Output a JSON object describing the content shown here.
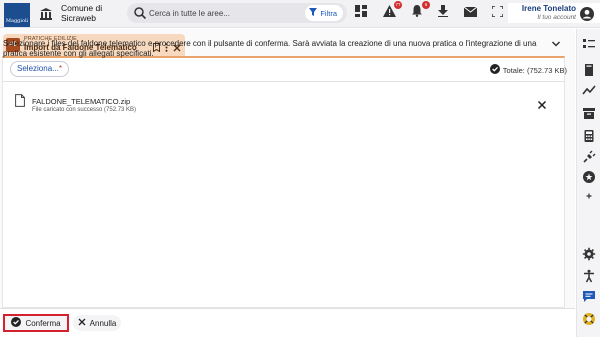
{
  "header": {
    "logo_text": "Maggioli",
    "org_line1": "Comune di",
    "org_line2": "Sicraweb",
    "search_placeholder": "Cerca in tutte le aree...",
    "filter_label": "Filtra",
    "alerts_count": "77",
    "notifications_count": "6",
    "user_name": "Irene Tonelato",
    "user_sub": "Il tuo account"
  },
  "tab": {
    "super_label": "PRATICHE EDILIZIE",
    "title": "Import da Faldone Telematico",
    "icon_text": "PE"
  },
  "content": {
    "instruction": "Selezionare i files del faldone telematico e procedere con il pulsante di conferma. Sarà avviata la creazione di una nuova pratica o l'integrazione di una pratica esistente con gli allegati specificati.",
    "select_label": "Seleziona...",
    "required_mark": "*",
    "total_label": "Totale: (752.73 KB)",
    "file": {
      "name": "FALDONE_TELEMATICO.zip",
      "status": "File caricato con successo (752.73 KB)"
    }
  },
  "footer": {
    "confirm_label": "Conferma",
    "cancel_label": "Annulla"
  },
  "colors": {
    "accent": "#1f4fa8",
    "tab_bg": "#f6d9bf",
    "tab_icon": "#a84a1f",
    "highlight": "#d3212f",
    "badge": "#d32f2f"
  }
}
